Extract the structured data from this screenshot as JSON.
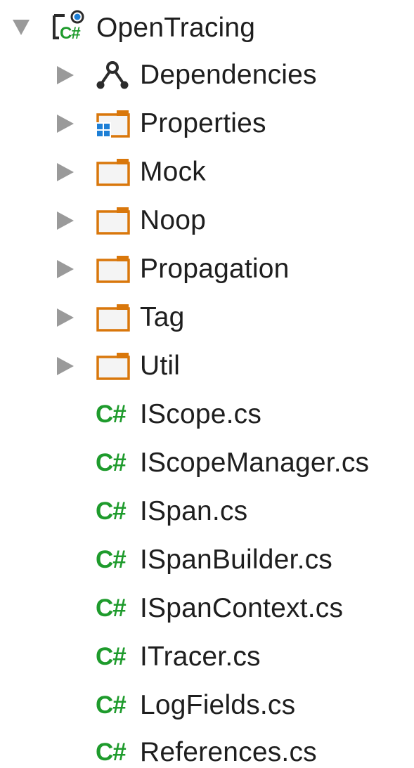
{
  "tree": {
    "root": {
      "label": "OpenTracing",
      "icon": "csharp-project-icon",
      "expanded": true
    },
    "children": [
      {
        "label": "Dependencies",
        "icon": "dependencies-icon",
        "expandable": true
      },
      {
        "label": "Properties",
        "icon": "properties-folder-icon",
        "expandable": true
      },
      {
        "label": "Mock",
        "icon": "folder-icon",
        "expandable": true
      },
      {
        "label": "Noop",
        "icon": "folder-icon",
        "expandable": true
      },
      {
        "label": "Propagation",
        "icon": "folder-icon",
        "expandable": true
      },
      {
        "label": "Tag",
        "icon": "folder-icon",
        "expandable": true
      },
      {
        "label": "Util",
        "icon": "folder-icon",
        "expandable": true
      },
      {
        "label": "IScope.cs",
        "icon": "csharp-file-icon",
        "expandable": false
      },
      {
        "label": "IScopeManager.cs",
        "icon": "csharp-file-icon",
        "expandable": false
      },
      {
        "label": "ISpan.cs",
        "icon": "csharp-file-icon",
        "expandable": false
      },
      {
        "label": "ISpanBuilder.cs",
        "icon": "csharp-file-icon",
        "expandable": false
      },
      {
        "label": "ISpanContext.cs",
        "icon": "csharp-file-icon",
        "expandable": false
      },
      {
        "label": "ITracer.cs",
        "icon": "csharp-file-icon",
        "expandable": false
      },
      {
        "label": "LogFields.cs",
        "icon": "csharp-file-icon",
        "expandable": false
      },
      {
        "label": "References.cs",
        "icon": "csharp-file-icon",
        "expandable": false
      }
    ],
    "file_icon_text": "C#",
    "colors": {
      "arrow": "#9a9a9a",
      "folder": "#d9770b",
      "folder_fill": "#f4f4f4",
      "csharp": "#1e9b2c",
      "properties_blue": "#1d7fd6",
      "project_blue": "#1d7fd6"
    }
  }
}
